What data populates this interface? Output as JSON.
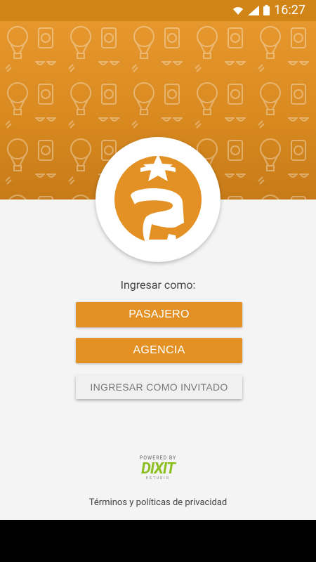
{
  "status_bar": {
    "time": "16:27",
    "icons": [
      "wifi-icon",
      "signal-icon",
      "battery-icon"
    ]
  },
  "login": {
    "prompt": "Ingresar como:",
    "pasajero_label": "PASAJERO",
    "agencia_label": "AGENCIA",
    "guest_label": "INGRESAR COMO INVITADO"
  },
  "footer": {
    "powered_by": "POWERED BY",
    "brand": "DIXIT",
    "brand_sub": "ESTUDIO",
    "terms": "Términos y políticas de privacidad"
  },
  "colors": {
    "accent": "#e39124",
    "status_bar": "#d18517",
    "brand_green": "#8dbf22"
  }
}
